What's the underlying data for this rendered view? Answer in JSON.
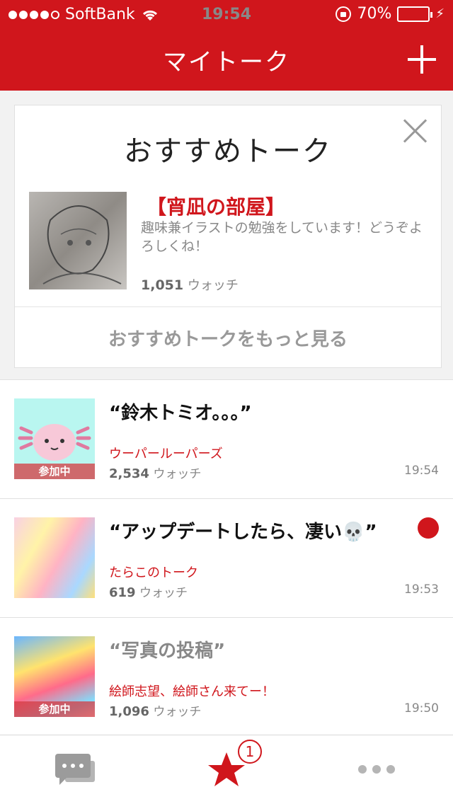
{
  "status_bar": {
    "carrier": "SoftBank",
    "time": "19:54",
    "battery": "70%"
  },
  "header": {
    "title": "マイトーク"
  },
  "recommendation": {
    "title": "おすすめトーク",
    "name": "【宵凪の部屋】",
    "description": "趣味兼イラストの勉強をしています！どうぞよろしくね！",
    "watch_count": "1,051",
    "watch_label": "ウォッチ",
    "more_label": "おすすめトークをもっと見る"
  },
  "talks": [
    {
      "title": "“鈴木トミオ。。。”",
      "group": "ウーパールーパーズ",
      "watch_count": "2,534",
      "watch_label": "ウォッチ",
      "time": "19:54",
      "joined_label": "参加中"
    },
    {
      "title": "“アップデートしたら、凄い💀”",
      "group": "たらこのトーク",
      "watch_count": "619",
      "watch_label": "ウォッチ",
      "time": "19:53"
    },
    {
      "title": "“写真の投稿”",
      "group": "絵師志望、絵師さん来てー！",
      "watch_count": "1,096",
      "watch_label": "ウォッチ",
      "time": "19:50",
      "joined_label": "参加中"
    }
  ],
  "tabbar": {
    "badge": "1"
  },
  "colors": {
    "brand_red": "#d0161c"
  }
}
